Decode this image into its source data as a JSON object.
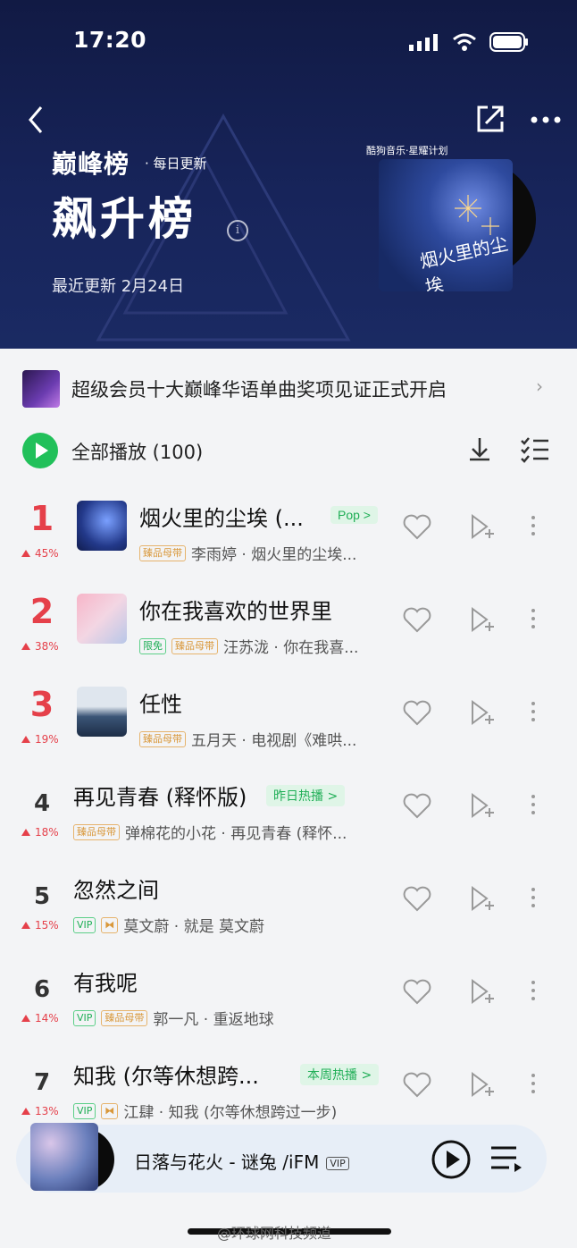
{
  "status_bar": {
    "time": "17:20"
  },
  "header": {
    "badge_title": "巅峰榜",
    "badge_sub": "· 每日更新",
    "chart_title": "飙升榜",
    "update_date": "最近更新 2月24日",
    "cover_label": "酷狗音乐·星耀计划",
    "cover_text": "烟火里的尘埃"
  },
  "banner": {
    "text": "超级会员十大巅峰华语单曲奖项见证正式开启"
  },
  "play_all": {
    "label": "全部播放 (100)"
  },
  "songs": [
    {
      "rank": "1",
      "trend": "45%",
      "title": "烟火里的尘埃 (...",
      "chip": "Pop >",
      "tags": [
        "臻品母带"
      ],
      "meta": "李雨婷 · 烟火里的尘埃..."
    },
    {
      "rank": "2",
      "trend": "38%",
      "title": "你在我喜欢的世界里",
      "chip": "",
      "tags": [
        "限免",
        "臻品母带"
      ],
      "meta": "汪苏泷 · 你在我喜..."
    },
    {
      "rank": "3",
      "trend": "19%",
      "title": "任性",
      "chip": "",
      "tags": [
        "臻品母带"
      ],
      "meta": "五月天 · 电视剧《难哄..."
    },
    {
      "rank": "4",
      "trend": "18%",
      "title": "再见青春 (释怀版)",
      "chip": "昨日热播 >",
      "tags": [
        "臻品母带"
      ],
      "meta": "弹棉花的小花 · 再见青春 (释怀..."
    },
    {
      "rank": "5",
      "trend": "15%",
      "title": "忽然之间",
      "chip": "",
      "tags": [
        "VIP",
        "⧓"
      ],
      "meta": "莫文蔚 · 就是 莫文蔚"
    },
    {
      "rank": "6",
      "trend": "14%",
      "title": "有我呢",
      "chip": "",
      "tags": [
        "VIP",
        "臻品母带"
      ],
      "meta": "郭一凡 · 重返地球"
    },
    {
      "rank": "7",
      "trend": "13%",
      "title": "知我 (尔等休想跨...",
      "chip": "本周热播 >",
      "tags": [
        "VIP",
        "⧓"
      ],
      "meta": "江肆 · 知我 (尔等休想跨过一步)"
    }
  ],
  "player": {
    "title": "日落与花火 - 谜兔 /iFM",
    "vip": "VIP"
  },
  "watermark": "@环球网科技频道",
  "colors": {
    "accent_green": "#21c05a",
    "rank_red": "#e5404a",
    "header_bg": "#17245a"
  }
}
